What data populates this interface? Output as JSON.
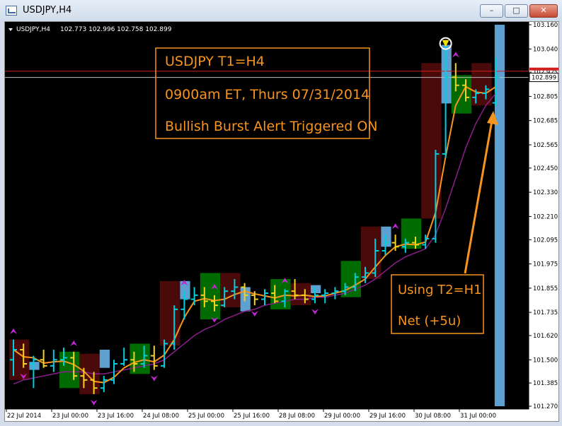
{
  "window": {
    "title": "USDJPY,H4",
    "minimize_glyph": "–",
    "maximize_glyph": "□",
    "close_glyph": "✕"
  },
  "chart_header": {
    "symbol_tf": "USDJPY,H4",
    "ohlc": "102.773 102.996 102.758 102.899",
    "dropdown_icon": "triangle-down-icon"
  },
  "annotations": {
    "box1_lines": [
      "USDJPY  T1=H4",
      "0900am ET, Thurs 07/31/2014",
      "Bullish Burst Alert Triggered ON"
    ],
    "box2_lines": [
      "Using T2=H1",
      "Net (+5u)"
    ],
    "arrow_color": "#f7941d",
    "text_color": "#f7941d"
  },
  "colors": {
    "background": "#000000",
    "up_bar": "#00cfe0",
    "down_bar": "#f5d21f",
    "green_zone": "#006b00",
    "maroon_zone": "#4a0a0a",
    "blue_zone": "#5ea0cf",
    "fast_ma": "#f7941d",
    "slow_ma": "#8a1e8a",
    "arrow_marker": "#c026d3",
    "price_line": "#d11e1e",
    "alert_signal": "#f0e000"
  },
  "chart_data": {
    "type": "ohlc",
    "symbol": "USDJPY",
    "timeframe": "H4",
    "ylim": [
      101.27,
      103.16
    ],
    "y_ticks": [
      103.16,
      103.04,
      102.925,
      102.805,
      102.685,
      102.565,
      102.45,
      102.33,
      102.21,
      102.095,
      101.975,
      101.855,
      101.735,
      101.62,
      101.5,
      101.385,
      101.27
    ],
    "x_tick_labels": [
      "22 Jul 2014",
      "23 Jul 00:00",
      "23 Jul 16:00",
      "24 Jul 08:00",
      "25 Jul 00:00",
      "25 Jul 16:00",
      "28 Jul 08:00",
      "29 Jul 00:00",
      "29 Jul 16:00",
      "30 Jul 08:00",
      "31 Jul 00:00"
    ],
    "current_price_label": "102.899",
    "current_price": 102.899,
    "red_line_price": 102.93,
    "bars": [
      {
        "o": 101.5,
        "h": 101.6,
        "l": 101.42,
        "c": 101.55
      },
      {
        "o": 101.55,
        "h": 101.58,
        "l": 101.46,
        "c": 101.48
      },
      {
        "o": 101.48,
        "h": 101.52,
        "l": 101.36,
        "c": 101.5
      },
      {
        "o": 101.5,
        "h": 101.55,
        "l": 101.46,
        "c": 101.47
      },
      {
        "o": 101.47,
        "h": 101.55,
        "l": 101.44,
        "c": 101.5
      },
      {
        "o": 101.5,
        "h": 101.56,
        "l": 101.47,
        "c": 101.51
      },
      {
        "o": 101.51,
        "h": 101.54,
        "l": 101.4,
        "c": 101.42
      },
      {
        "o": 101.42,
        "h": 101.46,
        "l": 101.36,
        "c": 101.4
      },
      {
        "o": 101.4,
        "h": 101.44,
        "l": 101.33,
        "c": 101.36
      },
      {
        "o": 101.36,
        "h": 101.42,
        "l": 101.34,
        "c": 101.4
      },
      {
        "o": 101.4,
        "h": 101.5,
        "l": 101.38,
        "c": 101.48
      },
      {
        "o": 101.48,
        "h": 101.56,
        "l": 101.47,
        "c": 101.5
      },
      {
        "o": 101.5,
        "h": 101.54,
        "l": 101.44,
        "c": 101.48
      },
      {
        "o": 101.48,
        "h": 101.57,
        "l": 101.46,
        "c": 101.52
      },
      {
        "o": 101.52,
        "h": 101.57,
        "l": 101.45,
        "c": 101.47
      },
      {
        "o": 101.47,
        "h": 101.6,
        "l": 101.46,
        "c": 101.58
      },
      {
        "o": 101.58,
        "h": 101.77,
        "l": 101.55,
        "c": 101.75
      },
      {
        "o": 101.75,
        "h": 101.84,
        "l": 101.7,
        "c": 101.8
      },
      {
        "o": 101.8,
        "h": 101.86,
        "l": 101.77,
        "c": 101.82
      },
      {
        "o": 101.82,
        "h": 101.86,
        "l": 101.76,
        "c": 101.79
      },
      {
        "o": 101.79,
        "h": 101.82,
        "l": 101.74,
        "c": 101.77
      },
      {
        "o": 101.77,
        "h": 101.86,
        "l": 101.76,
        "c": 101.84
      },
      {
        "o": 101.84,
        "h": 101.9,
        "l": 101.8,
        "c": 101.86
      },
      {
        "o": 101.86,
        "h": 101.88,
        "l": 101.79,
        "c": 101.82
      },
      {
        "o": 101.82,
        "h": 101.84,
        "l": 101.77,
        "c": 101.8
      },
      {
        "o": 101.8,
        "h": 101.85,
        "l": 101.77,
        "c": 101.83
      },
      {
        "o": 101.83,
        "h": 101.87,
        "l": 101.78,
        "c": 101.79
      },
      {
        "o": 101.79,
        "h": 101.85,
        "l": 101.76,
        "c": 101.84
      },
      {
        "o": 101.84,
        "h": 101.9,
        "l": 101.8,
        "c": 101.82
      },
      {
        "o": 101.82,
        "h": 101.85,
        "l": 101.78,
        "c": 101.8
      },
      {
        "o": 101.8,
        "h": 101.86,
        "l": 101.78,
        "c": 101.82
      },
      {
        "o": 101.82,
        "h": 101.85,
        "l": 101.78,
        "c": 101.83
      },
      {
        "o": 101.83,
        "h": 101.86,
        "l": 101.8,
        "c": 101.84
      },
      {
        "o": 101.84,
        "h": 101.88,
        "l": 101.82,
        "c": 101.86
      },
      {
        "o": 101.86,
        "h": 101.93,
        "l": 101.84,
        "c": 101.91
      },
      {
        "o": 101.91,
        "h": 101.96,
        "l": 101.88,
        "c": 101.93
      },
      {
        "o": 101.93,
        "h": 102.1,
        "l": 101.91,
        "c": 102.04
      },
      {
        "o": 102.04,
        "h": 102.12,
        "l": 102.02,
        "c": 102.08
      },
      {
        "o": 102.08,
        "h": 102.12,
        "l": 102.04,
        "c": 102.06
      },
      {
        "o": 102.06,
        "h": 102.1,
        "l": 102.03,
        "c": 102.08
      },
      {
        "o": 102.08,
        "h": 102.11,
        "l": 102.05,
        "c": 102.07
      },
      {
        "o": 102.07,
        "h": 102.12,
        "l": 102.05,
        "c": 102.1
      },
      {
        "o": 102.1,
        "h": 102.54,
        "l": 102.08,
        "c": 102.52
      },
      {
        "o": 102.52,
        "h": 103.06,
        "l": 102.5,
        "c": 102.9
      },
      {
        "o": 102.9,
        "h": 102.97,
        "l": 102.83,
        "c": 102.86
      },
      {
        "o": 102.86,
        "h": 102.89,
        "l": 102.78,
        "c": 102.8
      },
      {
        "o": 102.8,
        "h": 102.84,
        "l": 102.77,
        "c": 102.82
      },
      {
        "o": 102.82,
        "h": 102.86,
        "l": 102.79,
        "c": 102.84
      },
      {
        "o": 102.773,
        "h": 102.996,
        "l": 102.758,
        "c": 102.899
      }
    ],
    "slow_ma": [
      101.38,
      101.4,
      101.41,
      101.42,
      101.43,
      101.44,
      101.44,
      101.44,
      101.43,
      101.43,
      101.44,
      101.45,
      101.46,
      101.47,
      101.48,
      101.5,
      101.54,
      101.58,
      101.62,
      101.65,
      101.67,
      101.7,
      101.72,
      101.74,
      101.75,
      101.77,
      101.78,
      101.79,
      101.8,
      101.8,
      101.81,
      101.81,
      101.82,
      101.83,
      101.85,
      101.87,
      101.9,
      101.94,
      101.98,
      102.01,
      102.03,
      102.05,
      102.12,
      102.25,
      102.4,
      102.55,
      102.67,
      102.76,
      102.82
    ],
    "zones": [
      {
        "from": 0,
        "to": 2,
        "low": 101.4,
        "high": 101.6,
        "kind": "maroon"
      },
      {
        "from": 2,
        "to": 3,
        "low": 101.45,
        "high": 101.49,
        "kind": "blue"
      },
      {
        "from": 5,
        "to": 7,
        "low": 101.36,
        "high": 101.54,
        "kind": "green"
      },
      {
        "from": 7,
        "to": 9,
        "low": 101.33,
        "high": 101.53,
        "kind": "maroon"
      },
      {
        "from": 9,
        "to": 10,
        "low": 101.46,
        "high": 101.55,
        "kind": "blue"
      },
      {
        "from": 12,
        "to": 14,
        "low": 101.43,
        "high": 101.58,
        "kind": "green"
      },
      {
        "from": 15,
        "to": 17,
        "low": 101.57,
        "high": 101.89,
        "kind": "maroon"
      },
      {
        "from": 17,
        "to": 18,
        "low": 101.8,
        "high": 101.89,
        "kind": "blue"
      },
      {
        "from": 19,
        "to": 21,
        "low": 101.7,
        "high": 101.93,
        "kind": "green"
      },
      {
        "from": 21,
        "to": 23,
        "low": 101.76,
        "high": 101.93,
        "kind": "maroon"
      },
      {
        "from": 23,
        "to": 24,
        "low": 101.74,
        "high": 101.86,
        "kind": "blue"
      },
      {
        "from": 26,
        "to": 28,
        "low": 101.75,
        "high": 101.9,
        "kind": "green"
      },
      {
        "from": 28,
        "to": 30,
        "low": 101.77,
        "high": 101.88,
        "kind": "maroon"
      },
      {
        "from": 30,
        "to": 31,
        "low": 101.83,
        "high": 101.87,
        "kind": "blue"
      },
      {
        "from": 33,
        "to": 35,
        "low": 101.81,
        "high": 101.99,
        "kind": "green"
      },
      {
        "from": 35,
        "to": 37,
        "low": 101.9,
        "high": 102.16,
        "kind": "maroon"
      },
      {
        "from": 37,
        "to": 38,
        "low": 102.06,
        "high": 102.16,
        "kind": "blue"
      },
      {
        "from": 39,
        "to": 41,
        "low": 102.05,
        "high": 102.2,
        "kind": "green"
      },
      {
        "from": 41,
        "to": 43,
        "low": 102.2,
        "high": 102.97,
        "kind": "maroon"
      },
      {
        "from": 43,
        "to": 44,
        "low": 102.77,
        "high": 103.06,
        "kind": "blue"
      },
      {
        "from": 44,
        "to": 46,
        "low": 102.72,
        "high": 102.91,
        "kind": "green"
      },
      {
        "from": 46,
        "to": 48,
        "low": 102.76,
        "high": 102.97,
        "kind": "maroon"
      },
      {
        "from": 48.3,
        "to": 49.3,
        "low": 101.27,
        "high": 103.16,
        "kind": "blue"
      }
    ],
    "up_markers": [
      0,
      6,
      17,
      20,
      27,
      38,
      44
    ],
    "down_markers": [
      1,
      8,
      14,
      20,
      24,
      30
    ],
    "alert_bar": 43
  }
}
